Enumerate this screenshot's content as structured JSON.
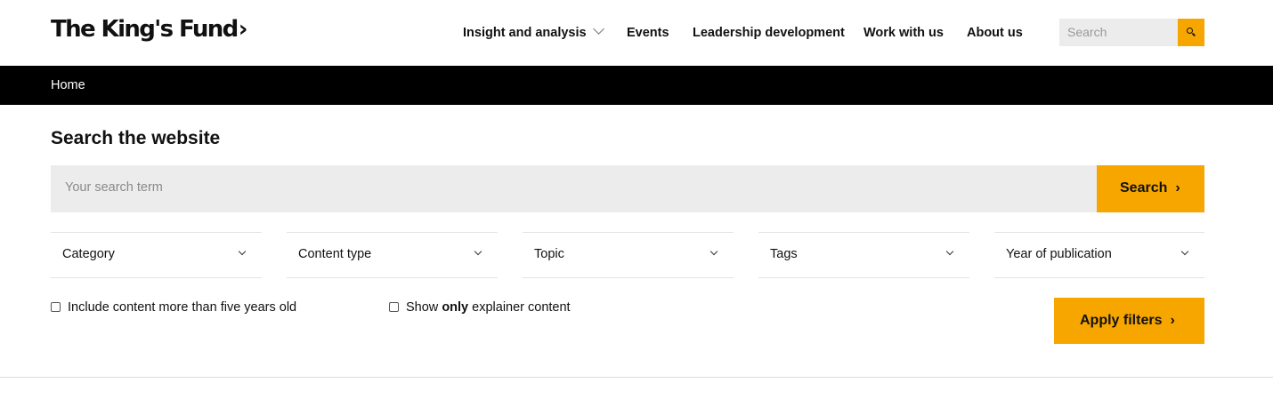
{
  "header": {
    "logo_text": "The King's Fund",
    "logo_chevron": "›",
    "nav": {
      "insight": "Insight and analysis",
      "events": "Events",
      "leadership": "Leadership development",
      "work": "Work with us",
      "about": "About us"
    },
    "search_placeholder": "Search",
    "search_icon": "search-icon"
  },
  "breadcrumb": {
    "home": "Home"
  },
  "main": {
    "title": "Search the website",
    "search_placeholder": "Your search term",
    "search_button": "Search",
    "filters": [
      "Category",
      "Content type",
      "Topic",
      "Tags",
      "Year of publication"
    ],
    "checkbox_old": "Include content more than five years old",
    "checkbox_explainer_pre": "Show ",
    "checkbox_explainer_bold": "only",
    "checkbox_explainer_post": " explainer content",
    "apply_button": "Apply filters"
  },
  "colors": {
    "accent": "#f7a600",
    "bar": "#000000",
    "field": "#ececec"
  }
}
